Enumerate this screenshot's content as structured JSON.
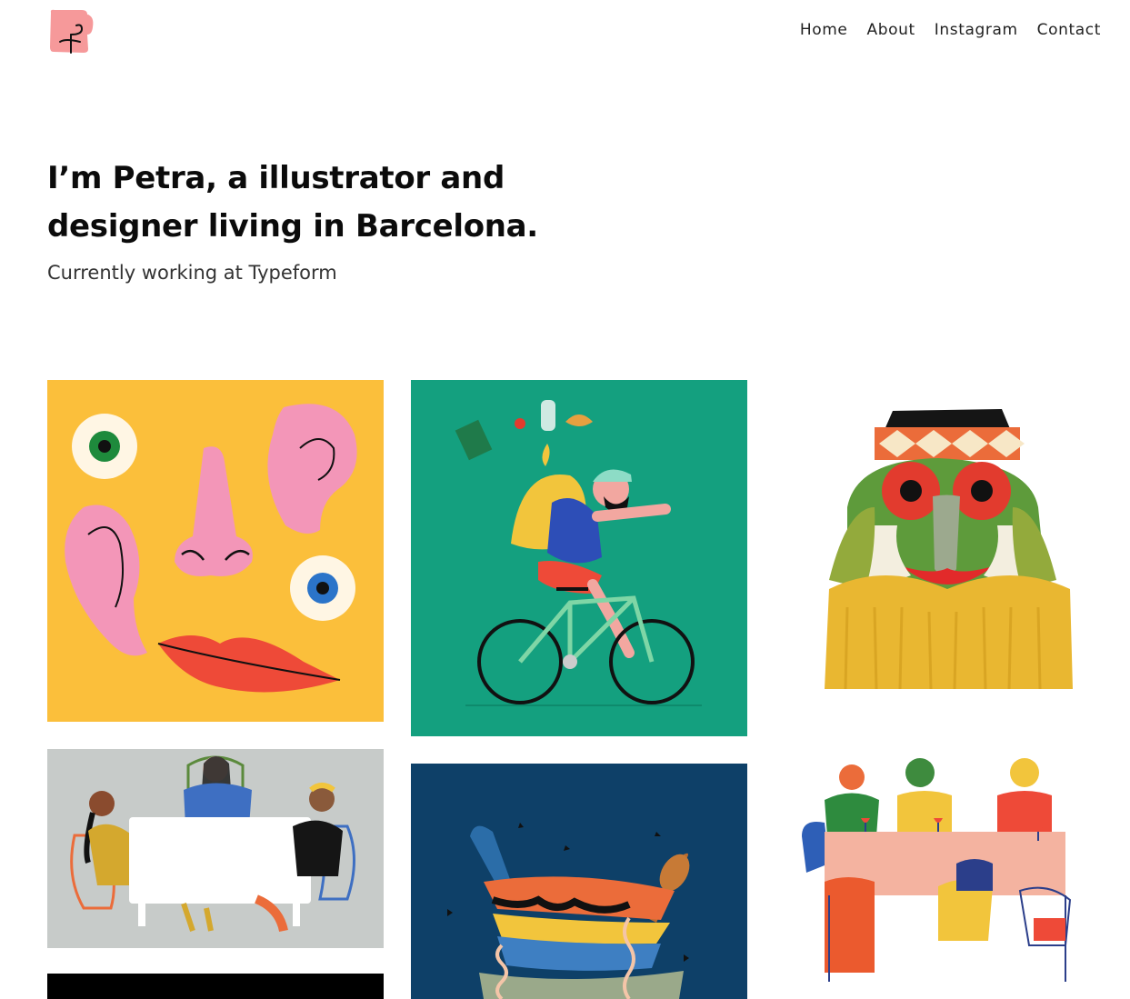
{
  "header": {
    "logo_icon": "pink-square-figure-logo",
    "nav": [
      {
        "label": "Home"
      },
      {
        "label": "About"
      },
      {
        "label": "Instagram"
      },
      {
        "label": "Contact"
      }
    ]
  },
  "hero": {
    "title_line1": "I’m Petra, a illustrator and",
    "title_line2": "designer living in Barcelona.",
    "subtitle": "Currently working at Typeform"
  },
  "gallery": {
    "tiles": [
      {
        "subject": "face-parts-illustration",
        "background": "#FBBF3B"
      },
      {
        "subject": "cyclist-delivery-illustration",
        "background": "#14A07F"
      },
      {
        "subject": "tribal-mask-illustration",
        "background": "#FFFFFF"
      },
      {
        "subject": "meeting-table-illustration",
        "background": "#C7CBC9"
      },
      {
        "subject": "stacked-bowls-illustration",
        "background": "#0E4068"
      },
      {
        "subject": "dinner-party-illustration",
        "background": "#FFFFFF"
      },
      {
        "subject": "dark-illustration",
        "background": "#000000"
      }
    ]
  }
}
